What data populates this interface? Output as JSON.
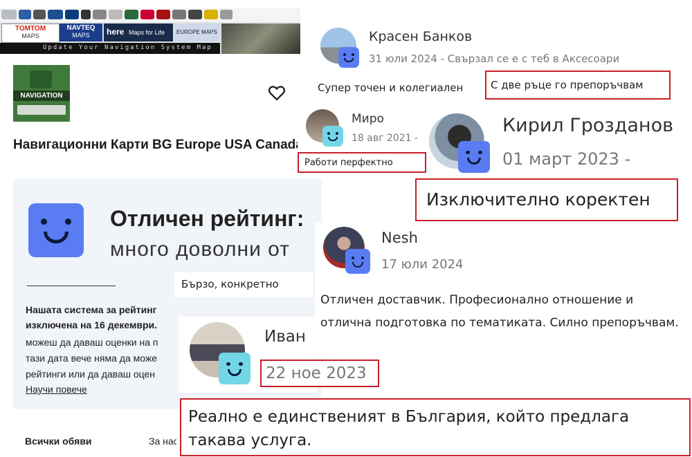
{
  "banner": {
    "tiles": [
      "TOMTOM",
      "NAVTEQ",
      "here",
      "Maps for Life",
      "EUROPE MAPS"
    ],
    "tomtom_sub": "MAPS",
    "navteq_sub": "MAPS",
    "update_line": "Update Your Navigation System Map"
  },
  "listing": {
    "app_icon_label": "NAVIGATION",
    "title": "Навигационни Карти BG Europe USA Canada",
    "favorite_icon": "heart-icon"
  },
  "rating_card": {
    "heading": "Отличен рейтинг:",
    "subheading": "много доволни от",
    "notice_lines": [
      "Нашата система за рейтинг",
      "изключена на 16 декември.",
      "можеш да даваш оценки на п",
      "тази дата вече няма да може",
      "рейтинги или да даваш оцен"
    ],
    "learn_more": "Научи повече",
    "all_ads": "Всички обяви",
    "for_partial": "За нас"
  },
  "reviews": [
    {
      "name": "Красен Банков",
      "meta": "31 юли 2024 - Свързал се е с теб в Аксесоари",
      "text_plain": "Супер точен и колегиален",
      "text_highlight": "С две ръце го препоръчвам"
    },
    {
      "name": "Миро",
      "meta": "18 авг 2021 -",
      "text_highlight": "Работи перфектно"
    },
    {
      "name": "Кирил Грозданов",
      "meta": "01 март 2023 -",
      "text_highlight": "Изключително коректен"
    },
    {
      "name": "Nesh",
      "meta": "17 юли 2024",
      "text": "Отличен доставчик. Професионално отношение и отлична подготовка по тематиката. Силно препоръчвам."
    },
    {
      "name": "",
      "meta": "",
      "text_highlight": "Бързо, конкретно"
    },
    {
      "name": "Иван",
      "meta": "22 ное 2023",
      "text_highlight": "Реално е единственият в България, който предлага такава услуга."
    }
  ],
  "colors": {
    "accent_blue": "#5a7cf2",
    "accent_teal": "#72d6e6",
    "highlight_red": "#c8202a"
  }
}
